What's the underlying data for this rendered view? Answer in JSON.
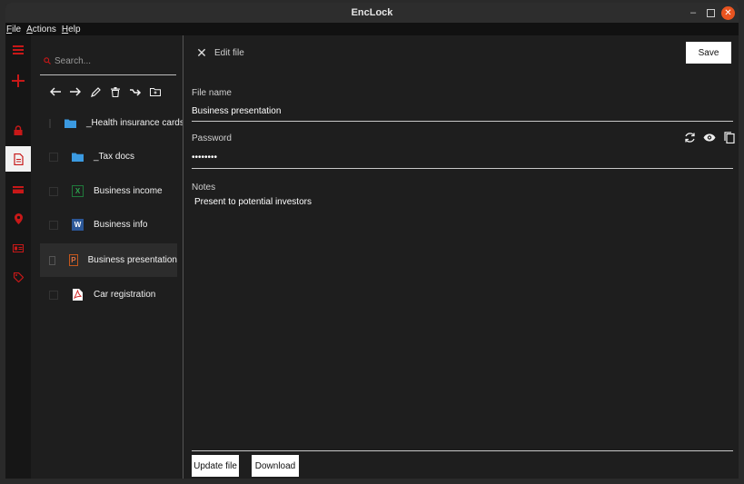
{
  "window": {
    "title": "EncLock"
  },
  "menu": {
    "items": [
      {
        "accel": "F",
        "rest": "ile"
      },
      {
        "accel": "A",
        "rest": "ctions"
      },
      {
        "accel": "H",
        "rest": "elp"
      }
    ]
  },
  "sidebar": {
    "icons": [
      "menu-icon",
      "add-icon",
      "lock-icon",
      "document-icon",
      "card-icon",
      "location-icon",
      "id-card-icon",
      "tag-icon"
    ],
    "active": "document-icon"
  },
  "search": {
    "placeholder": "Search..."
  },
  "toolbar": {
    "icons": [
      "back-arrow-icon",
      "forward-arrow-icon",
      "pencil-icon",
      "trash-icon",
      "move-icon",
      "new-folder-icon"
    ]
  },
  "files": [
    {
      "name": "_Health insurance cards",
      "type": "folder"
    },
    {
      "name": "_Tax docs",
      "type": "folder"
    },
    {
      "name": "Business income",
      "type": "excel",
      "badge": "X"
    },
    {
      "name": "Business info",
      "type": "word",
      "badge": "W"
    },
    {
      "name": "Business presentation",
      "type": "powerpoint",
      "badge": "P",
      "selected": true
    },
    {
      "name": "Car registration",
      "type": "pdf"
    }
  ],
  "detail": {
    "header": "Edit file",
    "save_label": "Save",
    "file_name_label": "File name",
    "file_name_value": "Business presentation",
    "password_label": "Password",
    "password_value": "••••••••",
    "notes_label": "Notes",
    "notes_value": "Present to potential investors",
    "update_label": "Update file",
    "download_label": "Download"
  },
  "colors": {
    "accent": "#c81818",
    "close_button": "#e95420",
    "folder": "#3b9ae1",
    "excel": "#1f7a3b",
    "word": "#2b5797",
    "powerpoint": "#c4571c",
    "pdf": "#d32f2f"
  }
}
